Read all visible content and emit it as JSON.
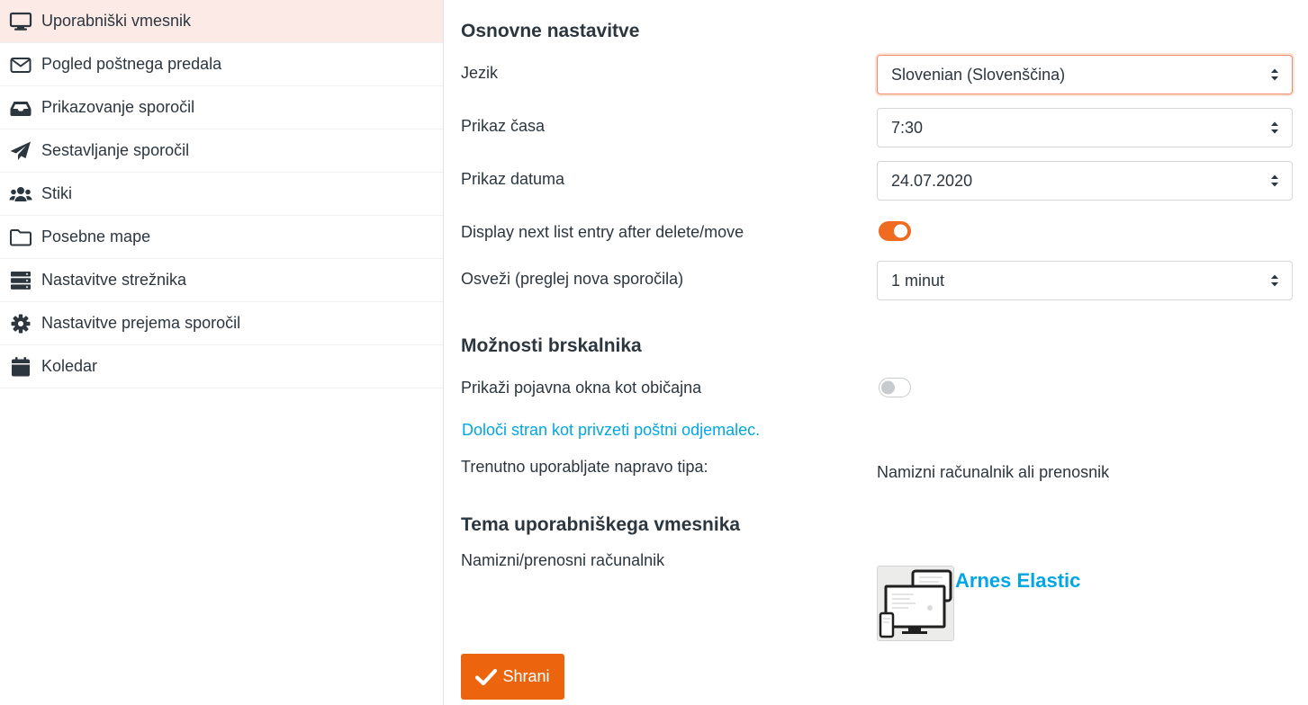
{
  "sidebar": {
    "items": [
      {
        "label": "Uporabniški vmesnik",
        "icon": "monitor-icon",
        "selected": true
      },
      {
        "label": "Pogled poštnega predala",
        "icon": "envelope-icon"
      },
      {
        "label": "Prikazovanje sporočil",
        "icon": "inbox-tray-icon"
      },
      {
        "label": "Sestavljanje sporočil",
        "icon": "paper-plane-icon"
      },
      {
        "label": "Stiki",
        "icon": "users-icon"
      },
      {
        "label": "Posebne mape",
        "icon": "folder-icon"
      },
      {
        "label": "Nastavitve strežnika",
        "icon": "server-icon"
      },
      {
        "label": "Nastavitve prejema sporočil",
        "icon": "gear-icon"
      },
      {
        "label": "Koledar",
        "icon": "calendar-icon"
      }
    ]
  },
  "main": {
    "basic": {
      "title": "Osnovne nastavitve",
      "language_label": "Jezik",
      "language_value": "Slovenian (Slovenščina)",
      "time_label": "Prikaz časa",
      "time_value": "7:30",
      "date_label": "Prikaz datuma",
      "date_value": "24.07.2020",
      "next_entry_label": "Display next list entry after delete/move",
      "next_entry_on": true,
      "refresh_label": "Osveži (preglej nova sporočila)",
      "refresh_value": "1 minut"
    },
    "browser": {
      "title": "Možnosti brskalnika",
      "popups_label": "Prikaži pojavna okna kot običajna",
      "popups_on": false,
      "default_client_link": "Določi stran kot privzeti poštni odjemalec.",
      "device_label": "Trenutno uporabljate napravo tipa:",
      "device_value": "Namizni računalnik ali prenosnik"
    },
    "theme": {
      "title": "Tema uporabniškega vmesnika",
      "device_label": "Namizni/prenosni računalnik",
      "skin_name": "Arnes Elastic"
    },
    "save_label": "Shrani"
  },
  "colors": {
    "accent": "#ee6b1f",
    "link": "#00a6e6",
    "selected_bg": "#fbeae5",
    "text": "#2c363f"
  }
}
